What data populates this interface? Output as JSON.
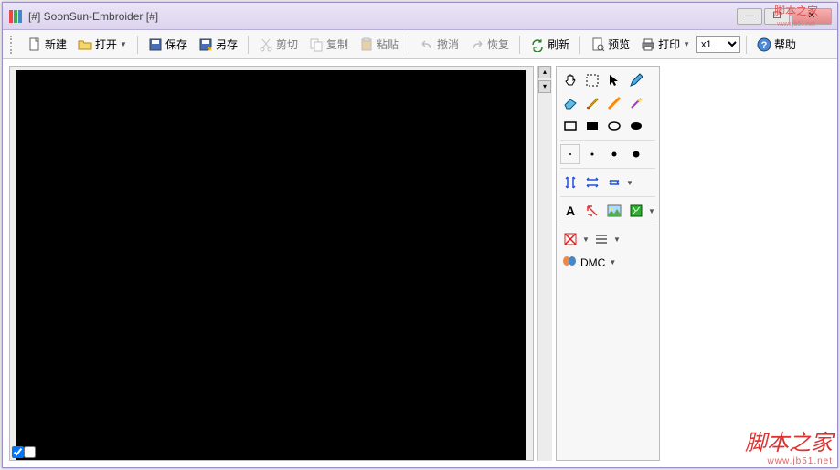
{
  "title": "[#] SoonSun-Embroider [#]",
  "toolbar": {
    "new_label": "新建",
    "open_label": "打开",
    "save_label": "保存",
    "saveas_label": "另存",
    "cut_label": "剪切",
    "copy_label": "复制",
    "paste_label": "粘贴",
    "undo_label": "撤消",
    "redo_label": "恢复",
    "refresh_label": "刷新",
    "preview_label": "预览",
    "print_label": "打印",
    "zoom_value": "x1",
    "help_label": "帮助"
  },
  "palette": {
    "dmc_label": "DMC"
  },
  "watermark": {
    "main": "脚本之家",
    "url": "www.jb51.net"
  }
}
